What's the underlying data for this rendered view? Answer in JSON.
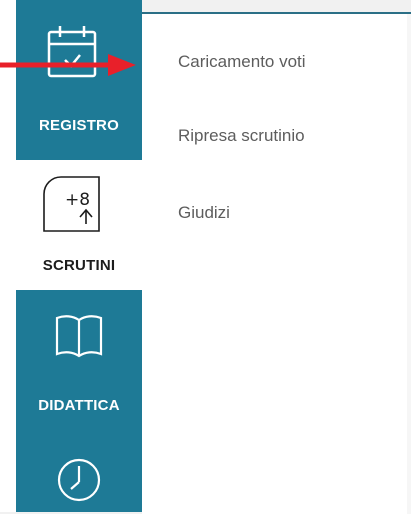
{
  "sidebar": {
    "items": [
      {
        "label": "REGISTRO",
        "icon": "calendar-check-icon",
        "active": false
      },
      {
        "label": "SCRUTINI",
        "icon": "grade-plus-icon",
        "active": true
      },
      {
        "label": "DIDATTICA",
        "icon": "book-icon",
        "active": false
      },
      {
        "label": "",
        "icon": "clock-icon",
        "active": false
      }
    ]
  },
  "submenu": {
    "items": [
      {
        "label": "Caricamento voti"
      },
      {
        "label": "Ripresa scrutinio"
      },
      {
        "label": "Giudizi"
      }
    ]
  },
  "annotation": {
    "icon": "red-arrow-icon",
    "color": "#e8202a"
  },
  "colors": {
    "sidebar_dark": "#1e7a96",
    "sidebar_active": "#ffffff",
    "menu_text": "#5d5d5d",
    "accent_line": "#2b6f86"
  }
}
